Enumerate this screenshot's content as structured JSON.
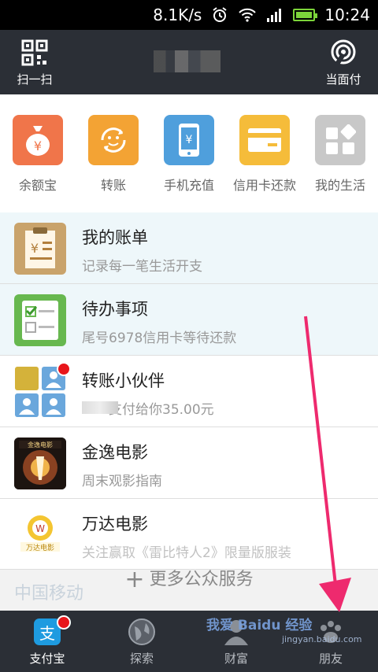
{
  "status_bar": {
    "speed": "8.1K/s",
    "time": "10:24"
  },
  "header": {
    "scan_label": "扫一扫",
    "pay_label": "当面付"
  },
  "apps": [
    {
      "label": "余额宝",
      "color": "#f0754a"
    },
    {
      "label": "转账",
      "color": "#f3a334"
    },
    {
      "label": "手机充值",
      "color": "#4f9fdc"
    },
    {
      "label": "信用卡还款",
      "color": "#f5bc3a"
    },
    {
      "label": "我的生活",
      "color": "#c8c8c8"
    }
  ],
  "list": [
    {
      "title": "我的账单",
      "subtitle": "记录每一笔生活开支"
    },
    {
      "title": "待办事项",
      "subtitle": "尾号6978信用卡等待还款"
    },
    {
      "title": "转账小伙伴",
      "subtitle": "支付给你35.00元"
    },
    {
      "title": "金逸电影",
      "subtitle": "周末观影指南"
    },
    {
      "title": "万达电影",
      "subtitle": "关注赢取《雷比特人2》限量版服装"
    }
  ],
  "more": {
    "label": "更多公众服务",
    "behind_text": "中国移动"
  },
  "tabbar": [
    {
      "label": "支付宝"
    },
    {
      "label": "探索"
    },
    {
      "label": "财富"
    },
    {
      "label": "朋友"
    }
  ],
  "watermark": {
    "main": "我爱 Baidu 经验",
    "sub": "jingyan.baidu.com"
  },
  "colors": {
    "header_bg": "#2b2f36",
    "highlight_row": "#eef7fa",
    "badge_red": "#e8161b",
    "arrow": "#ee2a6e"
  }
}
